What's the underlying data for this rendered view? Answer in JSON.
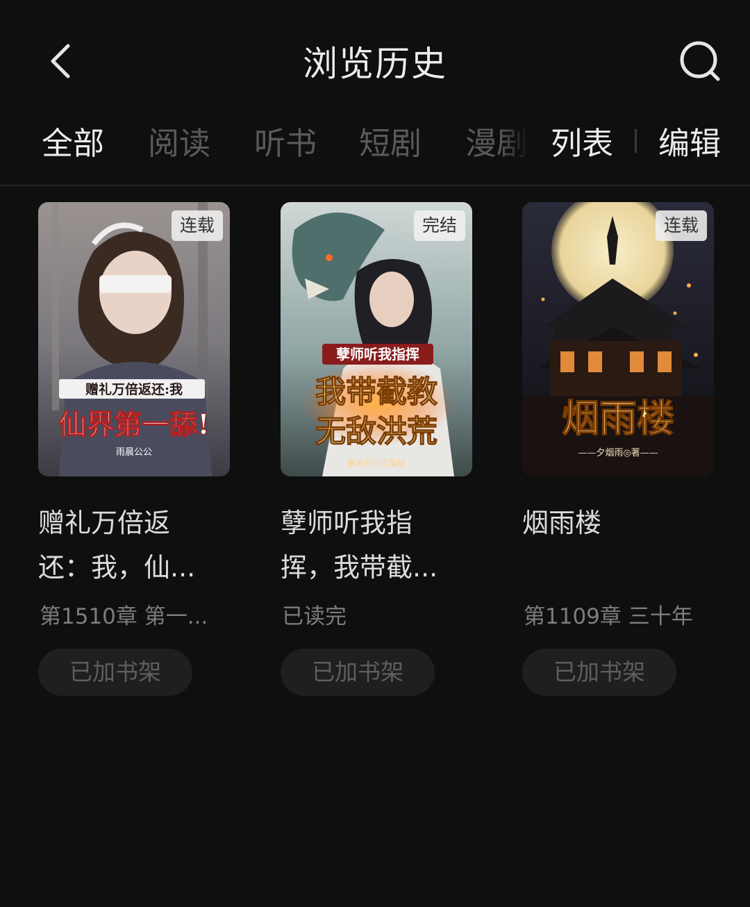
{
  "header": {
    "title": "浏览历史"
  },
  "tabs": [
    {
      "label": "全部",
      "active": true
    },
    {
      "label": "阅读",
      "active": false
    },
    {
      "label": "听书",
      "active": false
    },
    {
      "label": "短剧",
      "active": false
    },
    {
      "label": "漫剧",
      "active": false
    }
  ],
  "actions": {
    "list": "列表",
    "edit": "编辑"
  },
  "books": [
    {
      "title_line1": "赠礼万倍返",
      "title_line2": "还：我，仙...",
      "status_badge": "连载",
      "progress": "第1510章 第一...",
      "shelf_label": "已加书架",
      "cover": {
        "subtitle": "赠礼万倍返还:我",
        "main": "仙界第一舔!",
        "author": "雨晨公公"
      }
    },
    {
      "title_line1": "孽师听我指",
      "title_line2": "挥，我带截...",
      "status_badge": "完结",
      "progress": "已读完",
      "shelf_label": "已加书架",
      "cover": {
        "subtitle": "孽师听我指挥",
        "main_line1": "我带截教",
        "main_line2": "无敌洪荒",
        "author": "暴走的仙式蛋挞"
      }
    },
    {
      "title_line1": "烟雨楼",
      "title_line2": "",
      "status_badge": "连载",
      "progress": "第1109章 三十年",
      "shelf_label": "已加书架",
      "cover": {
        "main": "烟雨楼",
        "author": "——夕烟雨◎著——"
      }
    }
  ],
  "colors": {
    "background": "#0f0f0f",
    "accent_gold": "#f2c15a",
    "accent_red": "#c0392b"
  }
}
